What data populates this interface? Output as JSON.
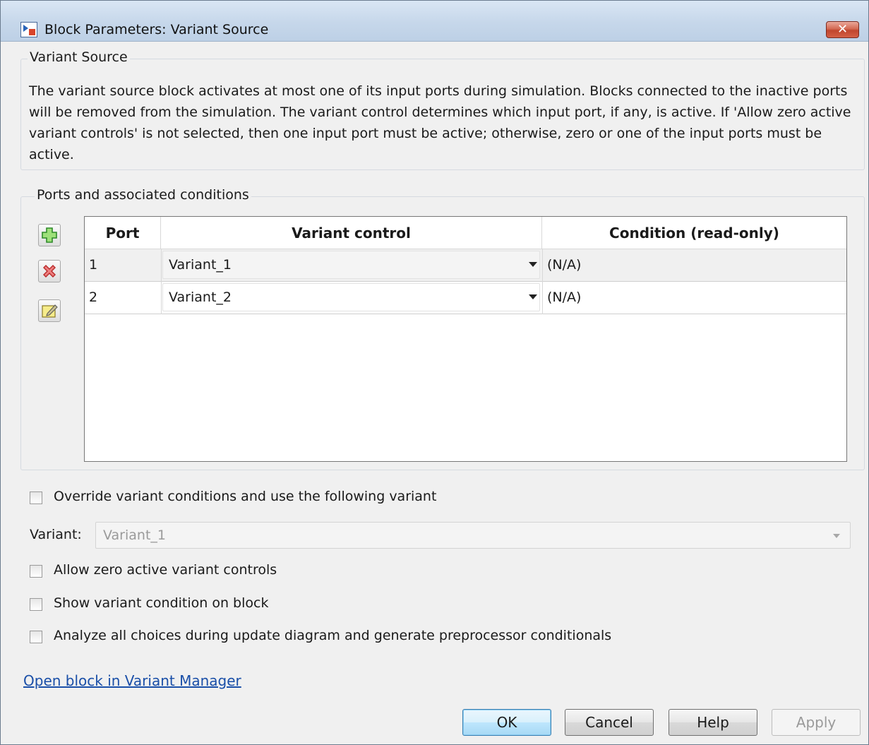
{
  "window": {
    "title": "Block Parameters: Variant Source",
    "close_label": "✕"
  },
  "variant_source": {
    "legend": "Variant Source",
    "description": "The variant source block activates at most one of its input ports during simulation. Blocks connected to the inactive ports will be removed from the simulation. The variant control determines which input port, if any, is active. If 'Allow zero active variant controls' is not selected, then one input port must be active; otherwise, zero or one of the input ports must be active."
  },
  "ports": {
    "legend": "Ports and associated conditions",
    "side_buttons": [
      {
        "name": "add",
        "icon": "plus-icon"
      },
      {
        "name": "delete",
        "icon": "delete-icon"
      },
      {
        "name": "edit",
        "icon": "edit-icon"
      }
    ],
    "columns": [
      "Port",
      "Variant control",
      "Condition (read-only)"
    ],
    "rows": [
      {
        "port": "1",
        "variant_control": "Variant_1",
        "condition": "(N/A)"
      },
      {
        "port": "2",
        "variant_control": "Variant_2",
        "condition": "(N/A)"
      }
    ]
  },
  "override": {
    "checkbox_label": "Override variant conditions and use the following variant",
    "checked": false,
    "variant_label": "Variant:",
    "variant_value": "Variant_1"
  },
  "options": [
    {
      "label": "Allow zero active variant controls",
      "checked": false
    },
    {
      "label": "Show variant condition on block",
      "checked": false
    },
    {
      "label": "Analyze all choices during update diagram and generate preprocessor conditionals",
      "checked": false
    }
  ],
  "link_text": "Open block in Variant Manager",
  "buttons": {
    "ok": "OK",
    "cancel": "Cancel",
    "help": "Help",
    "apply": "Apply"
  },
  "colors": {
    "link": "#1a4fa8",
    "default_button": "#3c7fb1",
    "close_button": "#c0462e"
  }
}
